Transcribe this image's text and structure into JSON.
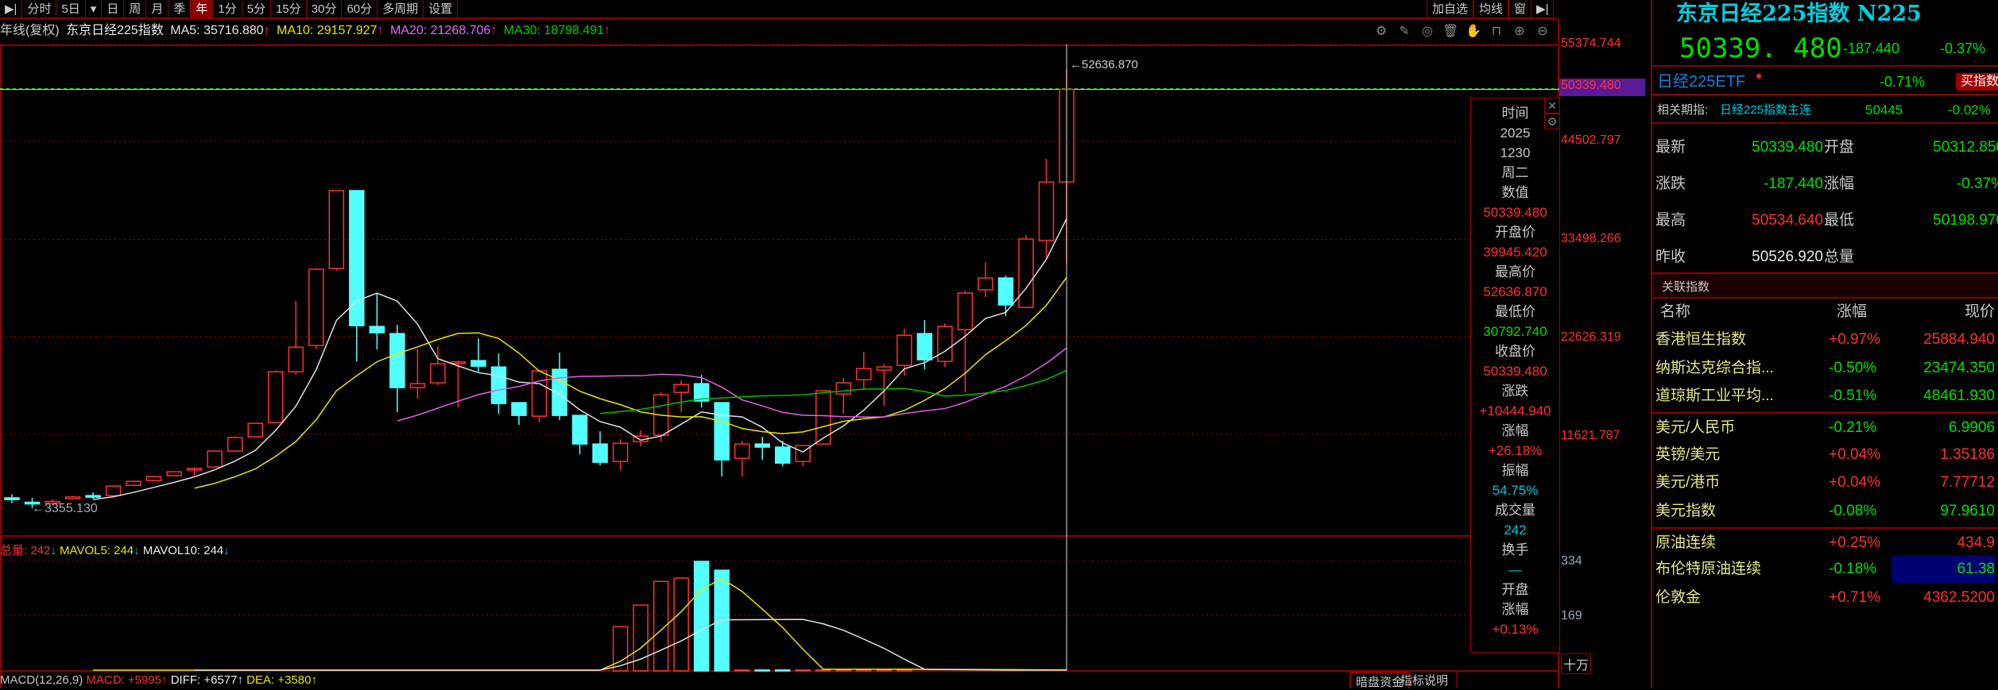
{
  "toolbar": {
    "items": [
      "分时",
      "5日",
      "▾",
      "日",
      "周",
      "月",
      "季",
      "年",
      "1分",
      "5分",
      "15分",
      "30分",
      "60分",
      "多周期",
      "设置"
    ],
    "active": "年",
    "right": [
      "加自选",
      "均线",
      "窗"
    ]
  },
  "ma_header": {
    "title": "年线(复权)",
    "name": "东京日经225指数",
    "ma5": "MA5: 35716.880",
    "ma10": "MA10: 29157.927",
    "ma20": "MA20: 21268.706",
    "ma30": "MA30: 18798.491",
    "arrow": "↑"
  },
  "price_axis": {
    "labels": [
      "55374.744",
      "44502.797",
      "33498.266",
      "22626.319",
      "11621.787"
    ],
    "current": "50339.480"
  },
  "annotations": {
    "high": "←52636.870",
    "low": "←3355.130"
  },
  "volume_header": {
    "total": "总量: 242",
    "mavol5": "MAVOL5: 244",
    "mavol10": "MAVOL10: 244",
    "arrow": "↓"
  },
  "volume_axis": {
    "labels": [
      "334",
      "169"
    ],
    "unit": "十万"
  },
  "macd_header": {
    "name": "MACD(12,26,9)",
    "macd": "MACD: +5995↑",
    "diff": "DIFF: +6577↑",
    "dea": "DEA: +3580↑"
  },
  "bottom_buttons": [
    "暗盘资金",
    "指标说明"
  ],
  "tooltip": {
    "items": [
      {
        "t": "时间",
        "c": "tg"
      },
      {
        "t": "2025",
        "c": "tg"
      },
      {
        "t": "1230",
        "c": "tg"
      },
      {
        "t": "周二",
        "c": "tg"
      },
      {
        "t": "数值",
        "c": "tg"
      },
      {
        "t": "50339.480",
        "c": "tr"
      },
      {
        "t": "开盘价",
        "c": "tg"
      },
      {
        "t": "39945.420",
        "c": "tr"
      },
      {
        "t": "最高价",
        "c": "tg"
      },
      {
        "t": "52636.870",
        "c": "tr"
      },
      {
        "t": "最低价",
        "c": "tg"
      },
      {
        "t": "30792.740",
        "c": "tgr"
      },
      {
        "t": "收盘价",
        "c": "tg"
      },
      {
        "t": "50339.480",
        "c": "tr"
      },
      {
        "t": "涨跌",
        "c": "tg"
      },
      {
        "t": "+10444.940",
        "c": "tr"
      },
      {
        "t": "涨幅",
        "c": "tg"
      },
      {
        "t": "+26.18%",
        "c": "tr"
      },
      {
        "t": "振幅",
        "c": "tg"
      },
      {
        "t": "54.75%",
        "c": "tc"
      },
      {
        "t": "成交量",
        "c": "tg"
      },
      {
        "t": "242",
        "c": "tc"
      },
      {
        "t": "换手",
        "c": "tg"
      },
      {
        "t": "—",
        "c": "tc"
      },
      {
        "t": "开盘",
        "c": "tg"
      },
      {
        "t": "涨幅",
        "c": "tg"
      },
      {
        "t": "+0.13%",
        "c": "tr"
      }
    ]
  },
  "panel": {
    "title": "东京日经225指数 N225",
    "price": "50339. 480",
    "change": "-187.440",
    "change_pct": "-0.37%",
    "etf": {
      "name": "日经225ETF",
      "pct": "-0.71%",
      "button": "买指数"
    },
    "futures": {
      "label": "相关期指:",
      "name": "日经225指数主连",
      "price": "50445",
      "pct": "-0.02%"
    },
    "quotes": [
      {
        "l1": "最新",
        "v1": "50339.480",
        "c1": "g",
        "l2": "开盘",
        "v2": "50312.850",
        "c2": "g"
      },
      {
        "l1": "涨跌",
        "v1": "-187.440",
        "c1": "g",
        "l2": "涨幅",
        "v2": "-0.37%",
        "c2": "g"
      },
      {
        "l1": "最高",
        "v1": "50534.640",
        "c1": "r",
        "l2": "最低",
        "v2": "50198.970",
        "c2": "g"
      },
      {
        "l1": "昨收",
        "v1": "50526.920",
        "c1": "w",
        "l2": "总量",
        "v2": "",
        "c2": "w"
      }
    ],
    "related_title": "关联指数",
    "columns": [
      "名称",
      "涨幅",
      "现价"
    ],
    "related": [
      {
        "name": "香港恒生指数",
        "pct": "+0.97%",
        "price": "25884.940",
        "c": "r"
      },
      {
        "name": "纳斯达克综合指...",
        "pct": "-0.50%",
        "price": "23474.350",
        "c": "g"
      },
      {
        "name": "道琼斯工业平均...",
        "pct": "-0.51%",
        "price": "48461.930",
        "c": "g"
      },
      {
        "name": "美元/人民币",
        "pct": "-0.21%",
        "price": "6.9906",
        "c": "g"
      },
      {
        "name": "英镑/美元",
        "pct": "+0.04%",
        "price": "1.35186",
        "c": "r"
      },
      {
        "name": "美元/港币",
        "pct": "+0.04%",
        "price": "7.77712",
        "c": "r"
      },
      {
        "name": "美元指数",
        "pct": "-0.08%",
        "price": "97.9610",
        "c": "g"
      },
      {
        "name": "原油连续",
        "pct": "+0.25%",
        "price": "434.9",
        "c": "r"
      },
      {
        "name": "布伦特原油连续",
        "pct": "-0.18%",
        "price": "61.38",
        "c": "g",
        "hl": true
      },
      {
        "name": "伦敦金",
        "pct": "+0.71%",
        "price": "4362.5200",
        "c": "r"
      }
    ]
  },
  "colors": {
    "up": "#ff3030",
    "down": "#54ffff",
    "ma5": "#e0e0e0",
    "ma10": "#e6e600",
    "ma20": "#e060e0",
    "ma30": "#00c000",
    "grid": "#a00000"
  },
  "chart_data": {
    "type": "candlestick",
    "title": "东京日经225指数 年线(复权)",
    "ylim": [
      3355.13,
      55374.744
    ],
    "ohlc": [
      [
        4500,
        4900,
        3900,
        4300
      ],
      [
        4000,
        4500,
        3355,
        3860
      ],
      [
        3900,
        4300,
        3700,
        4100
      ],
      [
        4400,
        4700,
        4300,
        4600
      ],
      [
        4750,
        5100,
        4400,
        4700
      ],
      [
        4750,
        5900,
        4700,
        5820
      ],
      [
        5900,
        6450,
        5800,
        6350
      ],
      [
        6440,
        7000,
        6350,
        6890
      ],
      [
        6980,
        7500,
        6900,
        7420
      ],
      [
        7780,
        7900,
        7000,
        7800
      ],
      [
        7960,
        9800,
        7900,
        9740
      ],
      [
        9740,
        11400,
        9650,
        11260
      ],
      [
        11340,
        12950,
        11250,
        12860
      ],
      [
        12950,
        18800,
        12850,
        18650
      ],
      [
        18650,
        26585,
        18300,
        21410
      ],
      [
        21590,
        30300,
        21200,
        30150
      ],
      [
        30240,
        39000,
        30000,
        38975
      ],
      [
        38975,
        38975,
        19810,
        23820
      ],
      [
        23730,
        27480,
        21150,
        23020
      ],
      [
        22930,
        23910,
        14110,
        16870
      ],
      [
        16870,
        21240,
        15620,
        17310
      ],
      [
        17400,
        21500,
        17130,
        19540
      ],
      [
        19720,
        19900,
        14650,
        19750
      ],
      [
        19900,
        22400,
        18650,
        19270
      ],
      [
        19180,
        20700,
        13910,
        15090
      ],
      [
        15180,
        15180,
        12680,
        13750
      ],
      [
        13660,
        18830,
        12950,
        18740
      ],
      [
        18920,
        20790,
        13220,
        13750
      ],
      [
        13750,
        13750,
        9380,
        10540
      ],
      [
        10540,
        11960,
        8140,
        8490
      ],
      [
        8580,
        11070,
        7600,
        10630
      ],
      [
        10810,
        12050,
        10270,
        11430
      ],
      [
        11520,
        16330,
        10810,
        16060
      ],
      [
        16330,
        17670,
        14110,
        17220
      ],
      [
        17310,
        18290,
        14640,
        15360
      ],
      [
        15180,
        15180,
        6890,
        8760
      ],
      [
        8940,
        10900,
        6890,
        10540
      ],
      [
        10540,
        11340,
        8760,
        10190
      ],
      [
        10190,
        10900,
        8050,
        8400
      ],
      [
        8580,
        10370,
        8050,
        10370
      ],
      [
        10540,
        16600,
        10450,
        16510
      ],
      [
        16150,
        17940,
        13930,
        17400
      ],
      [
        17760,
        20880,
        16600,
        19010
      ],
      [
        18830,
        19540,
        14820,
        19190
      ],
      [
        19370,
        23460,
        18200,
        22750
      ],
      [
        22930,
        24440,
        18920,
        19990
      ],
      [
        19810,
        24090,
        19190,
        23730
      ],
      [
        23370,
        27750,
        16330,
        27480
      ],
      [
        27840,
        30950,
        27030,
        29170
      ],
      [
        29170,
        29440,
        24890,
        26140
      ],
      [
        25870,
        33990,
        25790,
        33540
      ],
      [
        33360,
        42540,
        31400,
        39940
      ],
      [
        39945.42,
        52636.87,
        30792.74,
        50339.48
      ]
    ],
    "volume": [
      0,
      0,
      0,
      0,
      0,
      0,
      0,
      0,
      0,
      0,
      0,
      0,
      0,
      0,
      0,
      0,
      0,
      0,
      0,
      0,
      0,
      0,
      0,
      0,
      0,
      0,
      0,
      0,
      0,
      0,
      135,
      201,
      273,
      283,
      334,
      307,
      3,
      3,
      3,
      3,
      3,
      3,
      3,
      3,
      3,
      0,
      0,
      0,
      0,
      0,
      0,
      0,
      0
    ],
    "volume_ylim": [
      0,
      334
    ],
    "ma_periods": [
      5,
      10,
      20,
      30
    ],
    "mavol_periods": [
      5,
      10
    ]
  }
}
